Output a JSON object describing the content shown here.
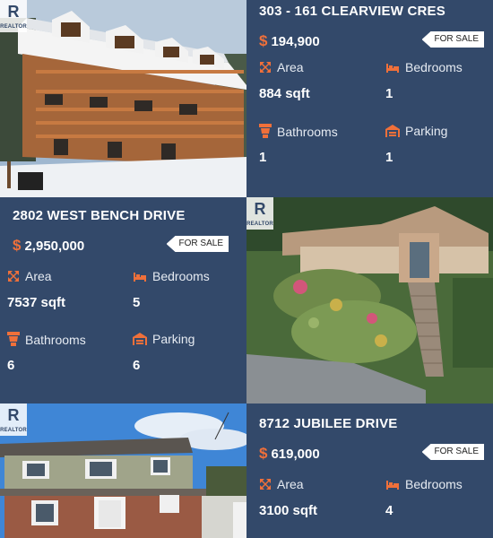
{
  "logo_text": "REALTOR",
  "listings": [
    {
      "address": "303 - 161 CLEARVIEW CRES",
      "price": "194,900",
      "status": "FOR SALE",
      "area_label": "Area",
      "area": "884 sqft",
      "bedrooms_label": "Bedrooms",
      "bedrooms": "1",
      "bathrooms_label": "Bathrooms",
      "bathrooms": "1",
      "parking_label": "Parking",
      "parking": "1"
    },
    {
      "address": "2802 WEST BENCH DRIVE",
      "price": "2,950,000",
      "status": "FOR SALE",
      "area_label": "Area",
      "area": "7537 sqft",
      "bedrooms_label": "Bedrooms",
      "bedrooms": "5",
      "bathrooms_label": "Bathrooms",
      "bathrooms": "6",
      "parking_label": "Parking",
      "parking": "6"
    },
    {
      "address": "8712 JUBILEE DRIVE",
      "price": "619,000",
      "status": "FOR SALE",
      "area_label": "Area",
      "area": "3100 sqft",
      "bedrooms_label": "Bedrooms",
      "bedrooms": "4"
    }
  ],
  "colors": {
    "card_bg": "#33496a",
    "accent": "#f0703a"
  }
}
